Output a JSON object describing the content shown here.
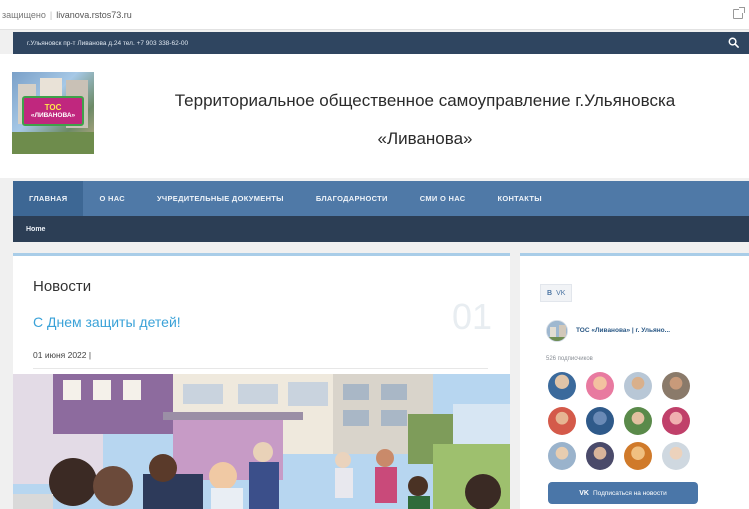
{
  "browser": {
    "secure_label": "защищено",
    "url": "livanova.rstos73.ru"
  },
  "topbar": {
    "contact": "г.Ульяновск пр-т Ливанова д.24 тел. +7 903 338-62-00"
  },
  "header": {
    "logo_line1": "ТОС",
    "logo_line2": "«ЛИВАНОВА»",
    "title_line1": "Территориальное общественное самоуправление г.Ульяновска",
    "title_line2": "«Ливанова»"
  },
  "nav": {
    "items": [
      {
        "label": "ГЛАВНАЯ"
      },
      {
        "label": "О НАС"
      },
      {
        "label": "УЧРЕДИТЕЛЬНЫЕ ДОКУМЕНТЫ"
      },
      {
        "label": "БЛАГОДАРНОСТИ"
      },
      {
        "label": "СМИ О НАС"
      },
      {
        "label": "КОНТАКТЫ"
      }
    ]
  },
  "breadcrumbs": {
    "home": "Home"
  },
  "news": {
    "heading": "Новости",
    "post_title": "С Днем защиты детей!",
    "post_number": "01",
    "post_date": "01 июня 2022 |"
  },
  "sidebar": {
    "vk_tab_icon": "B",
    "vk_tab_label": "VK",
    "group_name": "ТОС «Ливанова» | г. Ульяно...",
    "subscribers": "526 подписчиков",
    "subscribe_icon": "VK",
    "subscribe_button": "Подписаться на новости"
  },
  "colors": {
    "topbar": "#2f4560",
    "nav": "#4f79a7",
    "nav_active": "#3d6794",
    "breadcrumbs": "#2c3e55",
    "accent_link": "#3aa2d8",
    "vk_button": "#4a76a8"
  }
}
